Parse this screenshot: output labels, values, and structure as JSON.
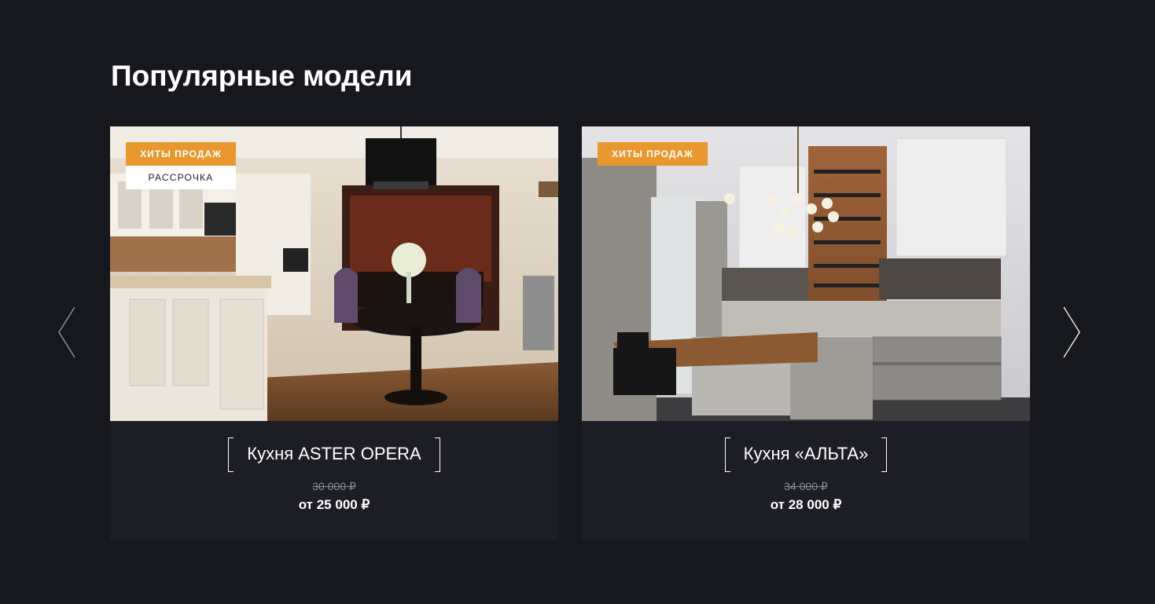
{
  "section": {
    "title": "Популярные модели"
  },
  "slider": {
    "prev_icon": "chevron-left-icon",
    "next_icon": "chevron-right-icon"
  },
  "products": [
    {
      "name": "Кухня ASTER OPERA",
      "badges": [
        "ХИТЫ ПРОДАЖ",
        "РАССРОЧКА"
      ],
      "old_price": "30 000 ₽",
      "price": "от 25 000 ₽"
    },
    {
      "name": "Кухня «АЛЬТА»",
      "badges": [
        "ХИТЫ ПРОДАЖ"
      ],
      "old_price": "34 000 ₽",
      "price": "от 28 000 ₽"
    }
  ],
  "colors": {
    "background": "#17181e",
    "card": "#1d1e25",
    "accent": "#e8982e"
  }
}
